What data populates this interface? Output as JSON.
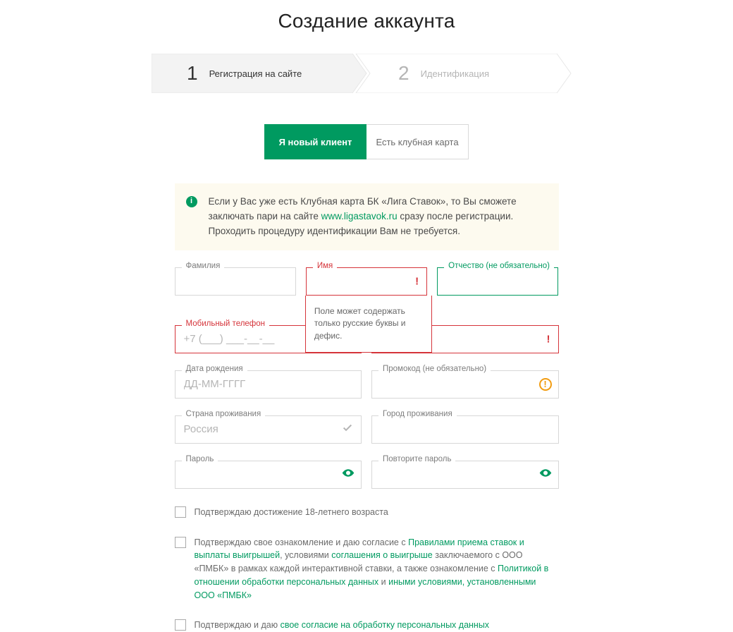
{
  "title": "Создание аккаунта",
  "stepper": {
    "steps": [
      {
        "num": "1",
        "label": "Регистрация на сайте"
      },
      {
        "num": "2",
        "label": "Идентификация"
      }
    ]
  },
  "tabs": {
    "new_client": "Я новый клиент",
    "has_card": "Есть клубная карта"
  },
  "info": {
    "text_before": "Если у Вас уже есть Клубная карта БК «Лига Ставок», то Вы сможете заключать пари на сайте ",
    "link_text": "www.ligastavok.ru",
    "text_after": " сразу после регистрации. Проходить процедуру идентификации Вам не требуется."
  },
  "fields": {
    "last_name": {
      "label": "Фамилия"
    },
    "first_name": {
      "label": "Имя",
      "tooltip": "Поле может содержать только русские буквы и дефис."
    },
    "patronymic": {
      "label": "Отчество  (не обязательно)"
    },
    "phone": {
      "label": "Мобильный телефон",
      "placeholder": "+7 (___) ___-__-__"
    },
    "email_hidden": {
      "label": ""
    },
    "birth": {
      "label": "Дата рождения",
      "placeholder": "ДД-ММ-ГГГГ"
    },
    "promo": {
      "label": "Промокод  (не обязательно)"
    },
    "country": {
      "label": "Страна проживания",
      "value": "Россия"
    },
    "city": {
      "label": "Город проживания"
    },
    "password": {
      "label": "Пароль"
    },
    "password2": {
      "label": "Повторите пароль"
    }
  },
  "checks": {
    "age": "Подтверждаю достижение 18-летнего возраста",
    "rules_p1": "Подтверждаю свое ознакомление и даю согласие с ",
    "rules_link1": "Правилами приема ставок и выплаты выигрышей",
    "rules_p2": ", условиями ",
    "rules_link2": "соглашения о выигрыше",
    "rules_p3": " заключаемого с ООО «ПМБК» в рамках каждой интерактивной ставки, а также ознакомление с ",
    "rules_link3": "Политикой в отношении обработки персональных данных",
    "rules_p4": " и ",
    "rules_link4": "иными условиями, установленными ООО «ПМБК»",
    "pdata_p1": "Подтверждаю и даю ",
    "pdata_link": "свое согласие на обработку персональных данных"
  }
}
